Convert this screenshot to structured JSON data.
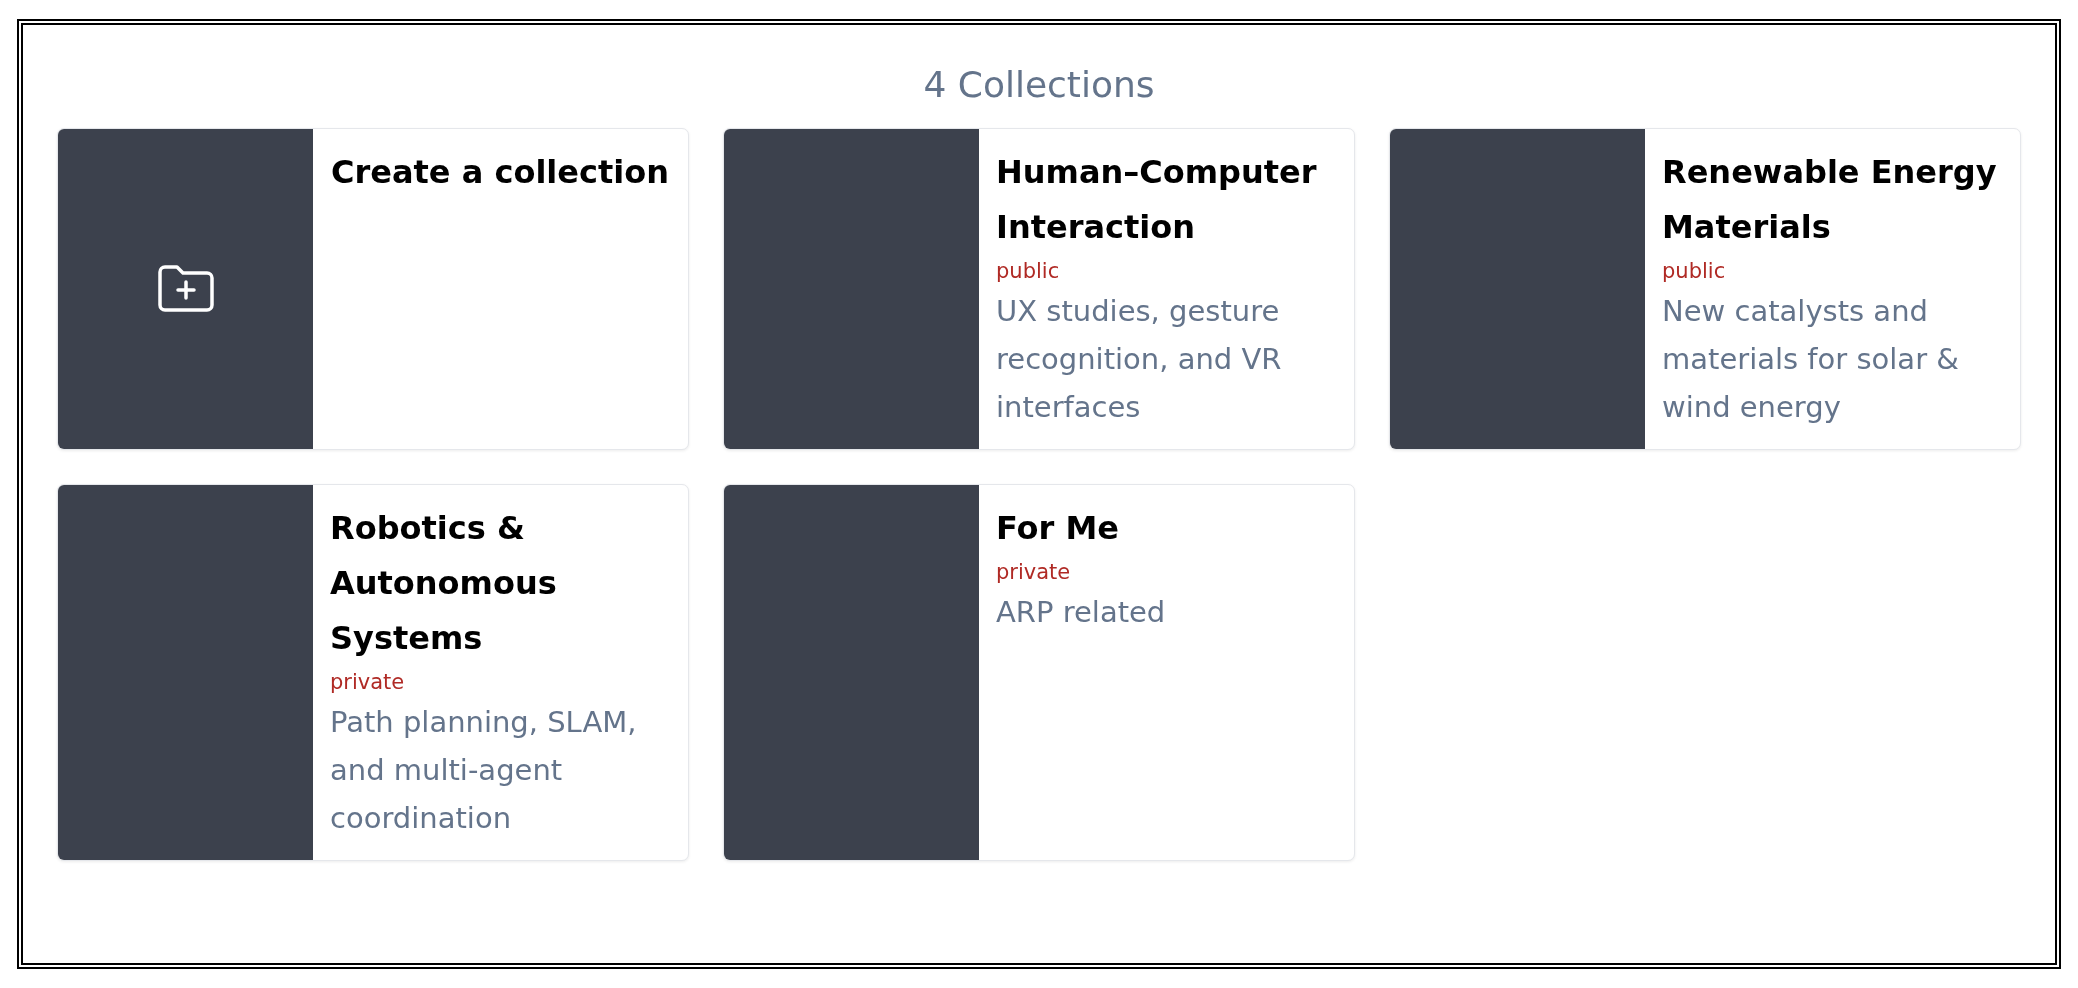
{
  "heading": "4 Collections",
  "cards": [
    {
      "kind": "create",
      "title": "Create a collection"
    },
    {
      "kind": "collection",
      "title": "Human–Computer Interaction",
      "visibility": "public",
      "description": "UX studies, gesture recognition, and VR interfaces"
    },
    {
      "kind": "collection",
      "title": "Renewable Energy Materials",
      "visibility": "public",
      "description": "New catalysts and materials for solar & wind energy"
    },
    {
      "kind": "collection",
      "title": "Robotics & Autonomous Systems",
      "visibility": "private",
      "description": "Path planning, SLAM, and multi-agent coordination"
    },
    {
      "kind": "collection",
      "title": "For Me",
      "visibility": "private",
      "description": "ARP related"
    }
  ]
}
